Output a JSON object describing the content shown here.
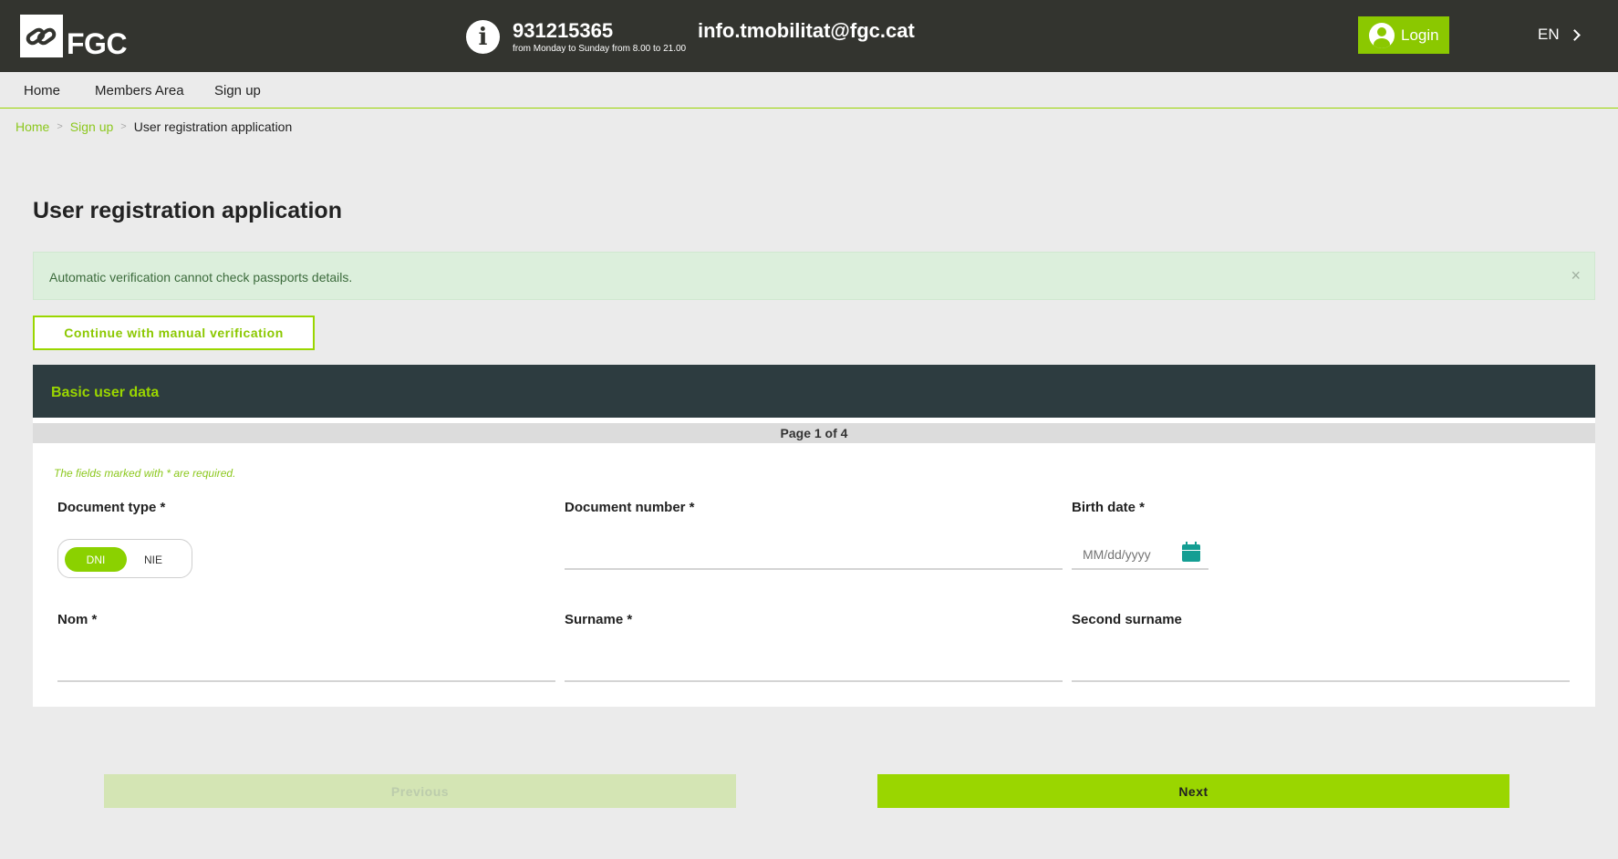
{
  "header": {
    "logo_text": "FGC",
    "phone": "931215365",
    "hours": "from Monday to Sunday from 8.00 to 21.00",
    "email": "info.tmobilitat@fgc.cat",
    "login_label": "Login",
    "language": "EN"
  },
  "nav": {
    "items": [
      {
        "label": "Home"
      },
      {
        "label": "Members Area"
      },
      {
        "label": "Sign up"
      }
    ]
  },
  "breadcrumb": {
    "home": "Home",
    "signup": "Sign up",
    "current": "User registration application",
    "separator": ">"
  },
  "page_title": "User registration application",
  "alert": {
    "text": "Automatic verification cannot check passports details.",
    "close": "×"
  },
  "manual_button": "Continue with manual verification",
  "panel": {
    "title": "Basic user data",
    "page_indicator": "Page 1 of 4",
    "required_note": "The fields marked with * are required."
  },
  "form": {
    "document_type": {
      "label": "Document type *",
      "options": [
        "DNI",
        "NIE"
      ],
      "selected": "DNI"
    },
    "document_number": {
      "label": "Document number *",
      "value": ""
    },
    "birth_date": {
      "label": "Birth date *",
      "placeholder": "MM/dd/yyyy"
    },
    "nom": {
      "label": "Nom *",
      "value": ""
    },
    "surname": {
      "label": "Surname *",
      "value": ""
    },
    "second_surname": {
      "label": "Second surname",
      "value": ""
    }
  },
  "footer_buttons": {
    "previous": "Previous",
    "next": "Next"
  },
  "colors": {
    "brand_green": "#9ad600",
    "header_dark": "#33342f",
    "panel_dark": "#2d3c40",
    "calendar_teal": "#149e93"
  }
}
